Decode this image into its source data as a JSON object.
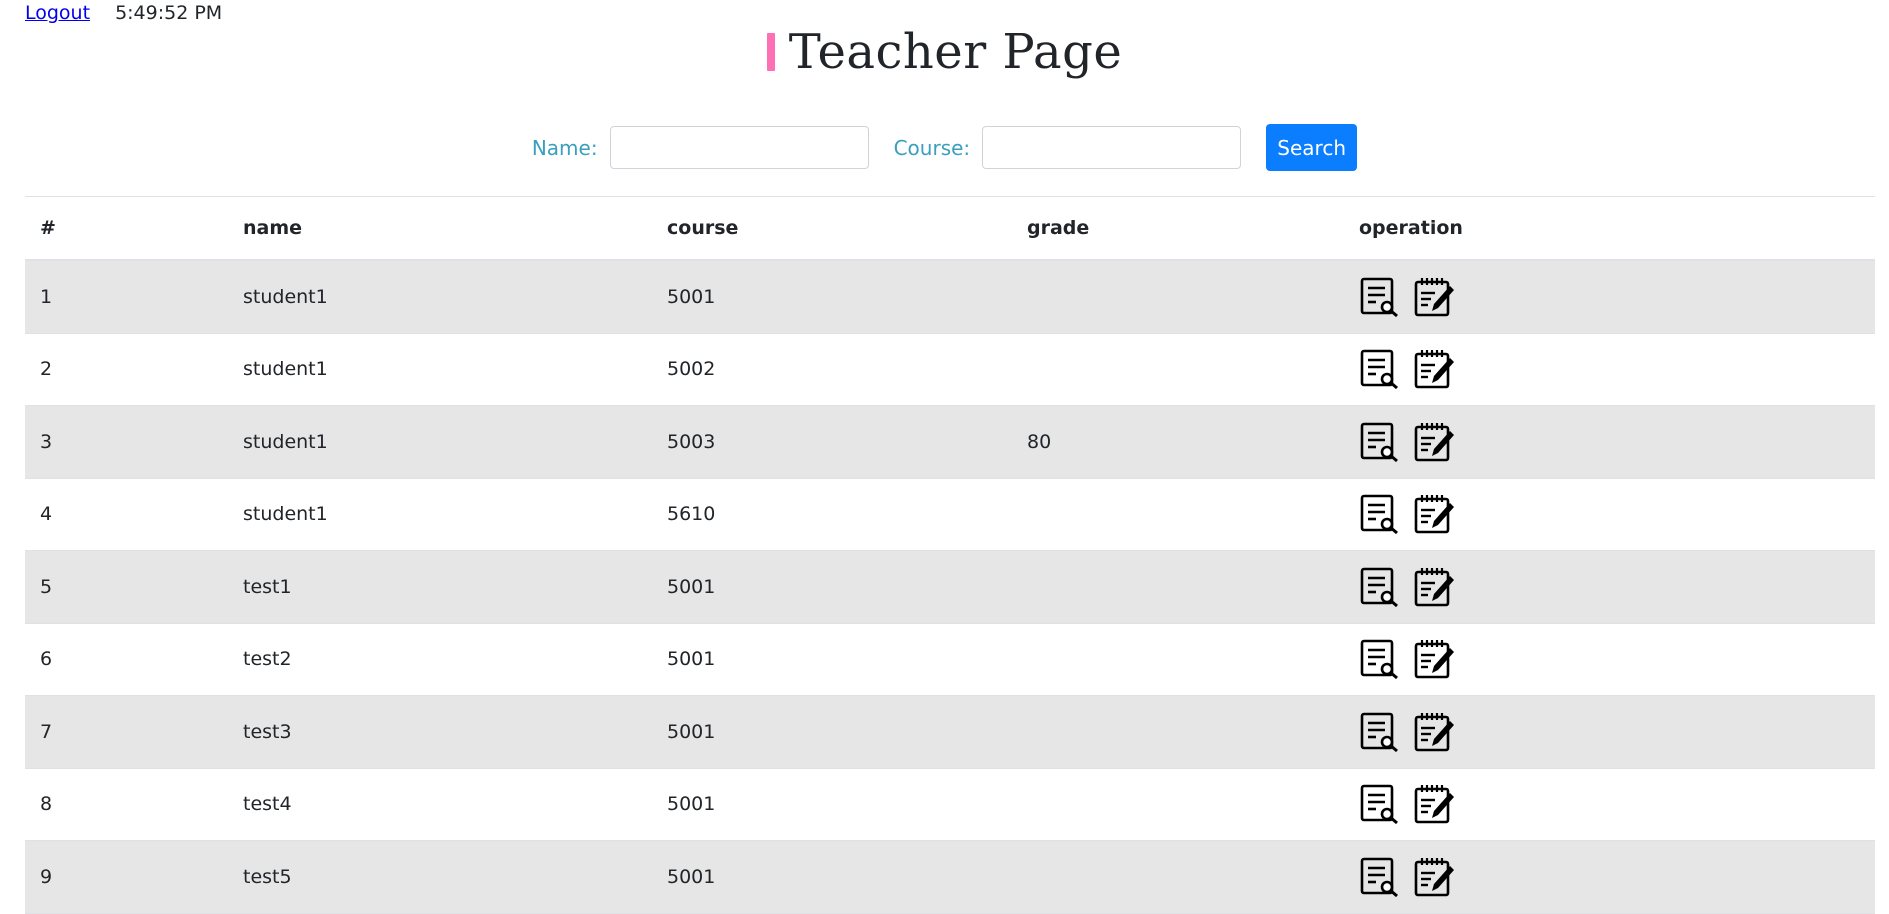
{
  "topbar": {
    "logout_label": "Logout",
    "time": "5:49:52 PM"
  },
  "page": {
    "title": "Teacher Page"
  },
  "search": {
    "name_label": "Name:",
    "name_value": "",
    "course_label": "Course:",
    "course_value": "",
    "button_label": "Search"
  },
  "table": {
    "headers": [
      "#",
      "name",
      "course",
      "grade",
      "operation"
    ],
    "rows": [
      {
        "num": "1",
        "name": "student1",
        "course": "5001",
        "grade": ""
      },
      {
        "num": "2",
        "name": "student1",
        "course": "5002",
        "grade": ""
      },
      {
        "num": "3",
        "name": "student1",
        "course": "5003",
        "grade": "80"
      },
      {
        "num": "4",
        "name": "student1",
        "course": "5610",
        "grade": ""
      },
      {
        "num": "5",
        "name": "test1",
        "course": "5001",
        "grade": ""
      },
      {
        "num": "6",
        "name": "test2",
        "course": "5001",
        "grade": ""
      },
      {
        "num": "7",
        "name": "test3",
        "course": "5001",
        "grade": ""
      },
      {
        "num": "8",
        "name": "test4",
        "course": "5001",
        "grade": ""
      },
      {
        "num": "9",
        "name": "test5",
        "course": "5001",
        "grade": ""
      }
    ],
    "operation_icons": [
      "document-search-icon",
      "edit-notepad-icon"
    ]
  },
  "colors": {
    "accent_bar": "#ff6fb5",
    "search_button": "#0b7dff",
    "label_text": "#3a9fbf",
    "striped_row": "#e6e6e6"
  }
}
